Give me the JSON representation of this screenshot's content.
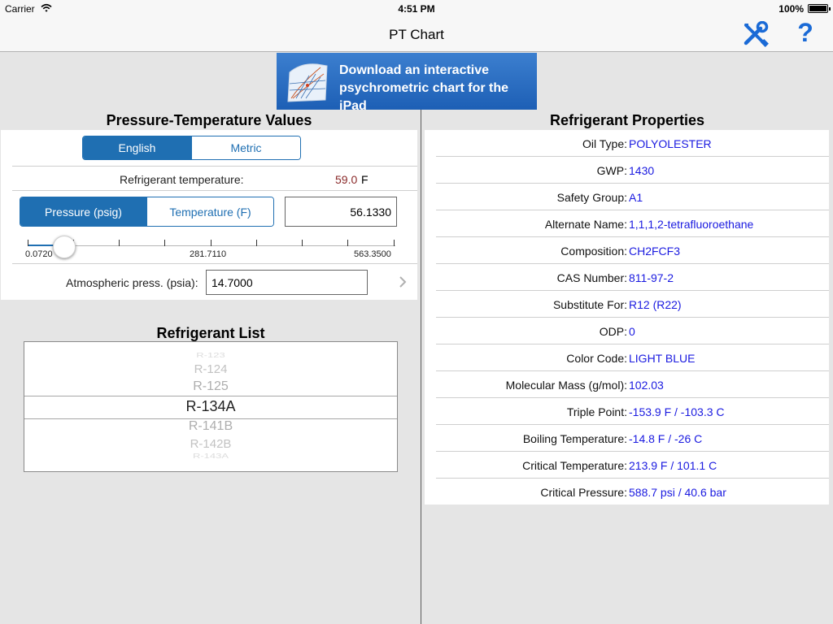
{
  "status_bar": {
    "carrier": "Carrier",
    "time": "4:51 PM",
    "battery": "100%",
    "battery_level": 1.0
  },
  "nav": {
    "title": "PT Chart",
    "help_label": "?"
  },
  "banner": {
    "line1": "Download an interactive",
    "line2": "psychrometric chart for the iPad"
  },
  "pt_section": {
    "title": "Pressure-Temperature Values",
    "units": [
      {
        "label": "English",
        "active": true
      },
      {
        "label": "Metric",
        "active": false
      }
    ],
    "refrigerant_temp_label": "Refrigerant temperature:",
    "refrigerant_temp_value": "59.0",
    "refrigerant_temp_unit": "F",
    "mode": [
      {
        "label": "Pressure (psig)",
        "active": true
      },
      {
        "label": "Temperature (F)",
        "active": false
      }
    ],
    "input_value": "56.1330",
    "slider": {
      "min": 0.072,
      "mid_label": "281.7110",
      "max": 563.35,
      "min_label": "0.0720",
      "max_label": "563.3500",
      "value": 56.133
    },
    "atm_label": "Atmospheric press. (psia):",
    "atm_value": "14.7000"
  },
  "refrigerant_list": {
    "title": "Refrigerant List",
    "items": [
      "R-123",
      "R-124",
      "R-125",
      "R-134A",
      "R-141B",
      "R-142B",
      "R-143A"
    ],
    "selected": "R-134A"
  },
  "properties": {
    "title": "Refrigerant Properties",
    "rows": [
      {
        "label": "Oil Type:",
        "value": "POLYOLESTER"
      },
      {
        "label": "GWP:",
        "value": "1430"
      },
      {
        "label": "Safety Group:",
        "value": "A1"
      },
      {
        "label": "Alternate Name:",
        "value": "1,1,1,2-tetrafluoroethane"
      },
      {
        "label": "Composition:",
        "value": "CH2FCF3"
      },
      {
        "label": "CAS Number:",
        "value": "811-97-2"
      },
      {
        "label": "Substitute For:",
        "value": "R12 (R22)"
      },
      {
        "label": "ODP:",
        "value": "0"
      },
      {
        "label": "Color Code:",
        "value": "LIGHT BLUE"
      },
      {
        "label": "Molecular Mass (g/mol):",
        "value": "102.03"
      },
      {
        "label": "Triple Point:",
        "value": "-153.9 F / -103.3 C"
      },
      {
        "label": "Boiling Temperature:",
        "value": "-14.8 F / -26 C"
      },
      {
        "label": "Critical Temperature:",
        "value": "213.9 F / 101.1 C"
      },
      {
        "label": "Critical Pressure:",
        "value": "588.7 psi / 40.6 bar"
      }
    ]
  },
  "colors": {
    "accent": "#1f6fb2",
    "nav_icon": "#1a6ad6",
    "prop_value": "#1a1ae0",
    "temp_value": "#8a2a2a"
  },
  "icons": [
    "wifi-icon",
    "battery-icon",
    "tools-icon",
    "help-icon",
    "chevron-right-icon",
    "psychrometric-chart-icon"
  ]
}
